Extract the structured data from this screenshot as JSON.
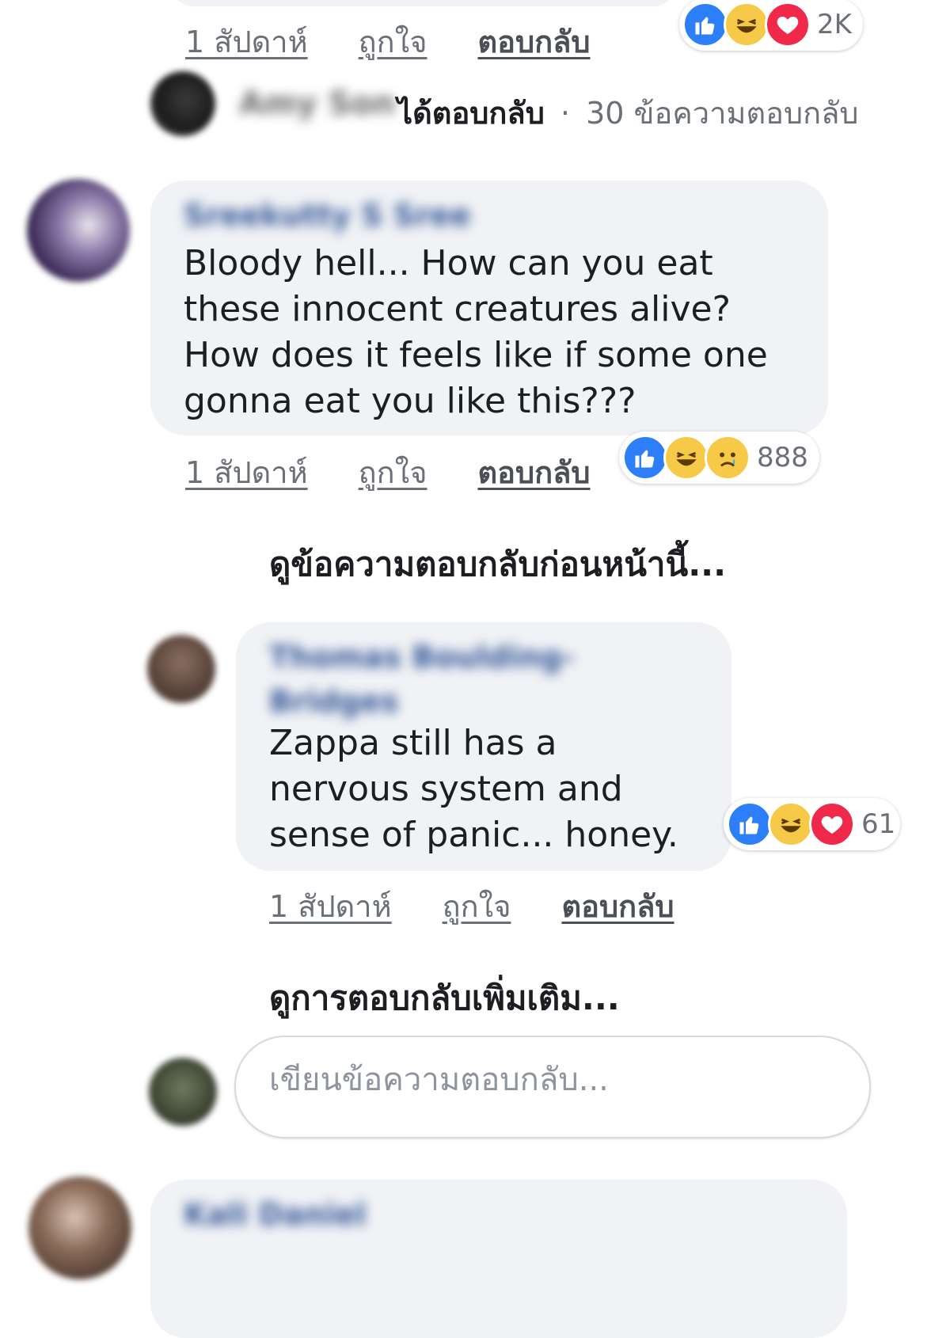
{
  "top_comment": {
    "time": "1 สัปดาห์",
    "like_label": "ถูกใจ",
    "reply_label": "ตอบกลับ",
    "reaction_count": "2K",
    "reaction_icons": [
      "like-icon",
      "haha-icon",
      "love-icon"
    ]
  },
  "reply_summary": {
    "author": "Amy Son",
    "replied_label": "ได้ตอบกลับ",
    "separator": "·",
    "count_text": "30 ข้อความตอบกลับ"
  },
  "comment1": {
    "author": "Sreekutty S Sree",
    "lines": [
      "Bloody hell... How can you eat",
      "these innocent creatures alive?",
      "How does it feels like if some one",
      "gonna eat you like this???"
    ],
    "time": "1 สัปดาห์",
    "like_label": "ถูกใจ",
    "reply_label": "ตอบกลับ",
    "reaction_count": "888",
    "reaction_icons": [
      "like-icon",
      "haha-icon",
      "sad-icon"
    ]
  },
  "see_previous_replies": "ดูข้อความตอบกลับก่อนหน้านี้...",
  "reply1": {
    "author_line1": "Thomas Boulding-",
    "author_line2": "Bridges",
    "lines": [
      "Zappa still has a",
      "nervous system and",
      "sense of panic... honey."
    ],
    "time": "1 สัปดาห์",
    "like_label": "ถูกใจ",
    "reply_label": "ตอบกลับ",
    "reaction_count": "61",
    "reaction_icons": [
      "like-icon",
      "haha-icon",
      "love-icon"
    ]
  },
  "see_more_replies": "ดูการตอบกลับเพิ่มเติม...",
  "reply_input": {
    "placeholder": "เขียนข้อความตอบกลับ...",
    "value": ""
  },
  "next_comment": {
    "author": "Kali Daniel"
  },
  "colors": {
    "like": "#2d7ff9",
    "haha": "#f7c948",
    "love": "#f0284a",
    "bubble": "#f0f2f5"
  }
}
